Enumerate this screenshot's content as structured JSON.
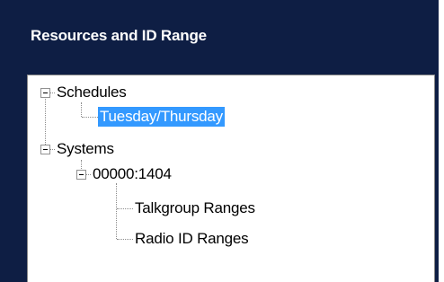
{
  "panel": {
    "title": "Resources and ID Range"
  },
  "tree": {
    "schedules": {
      "label": "Schedules",
      "expanded": true,
      "children": [
        {
          "label": "Tuesday/Thursday",
          "selected": true
        }
      ]
    },
    "systems": {
      "label": "Systems",
      "expanded": true,
      "children": [
        {
          "label": "00000:1404",
          "expanded": true,
          "children": [
            {
              "label": "Talkgroup Ranges"
            },
            {
              "label": "Radio ID Ranges"
            }
          ]
        }
      ]
    }
  },
  "colors": {
    "panel_background": "#0e1e44",
    "selection": "#3399ff"
  },
  "icons": {
    "expander": "collapse-minus-icon"
  }
}
